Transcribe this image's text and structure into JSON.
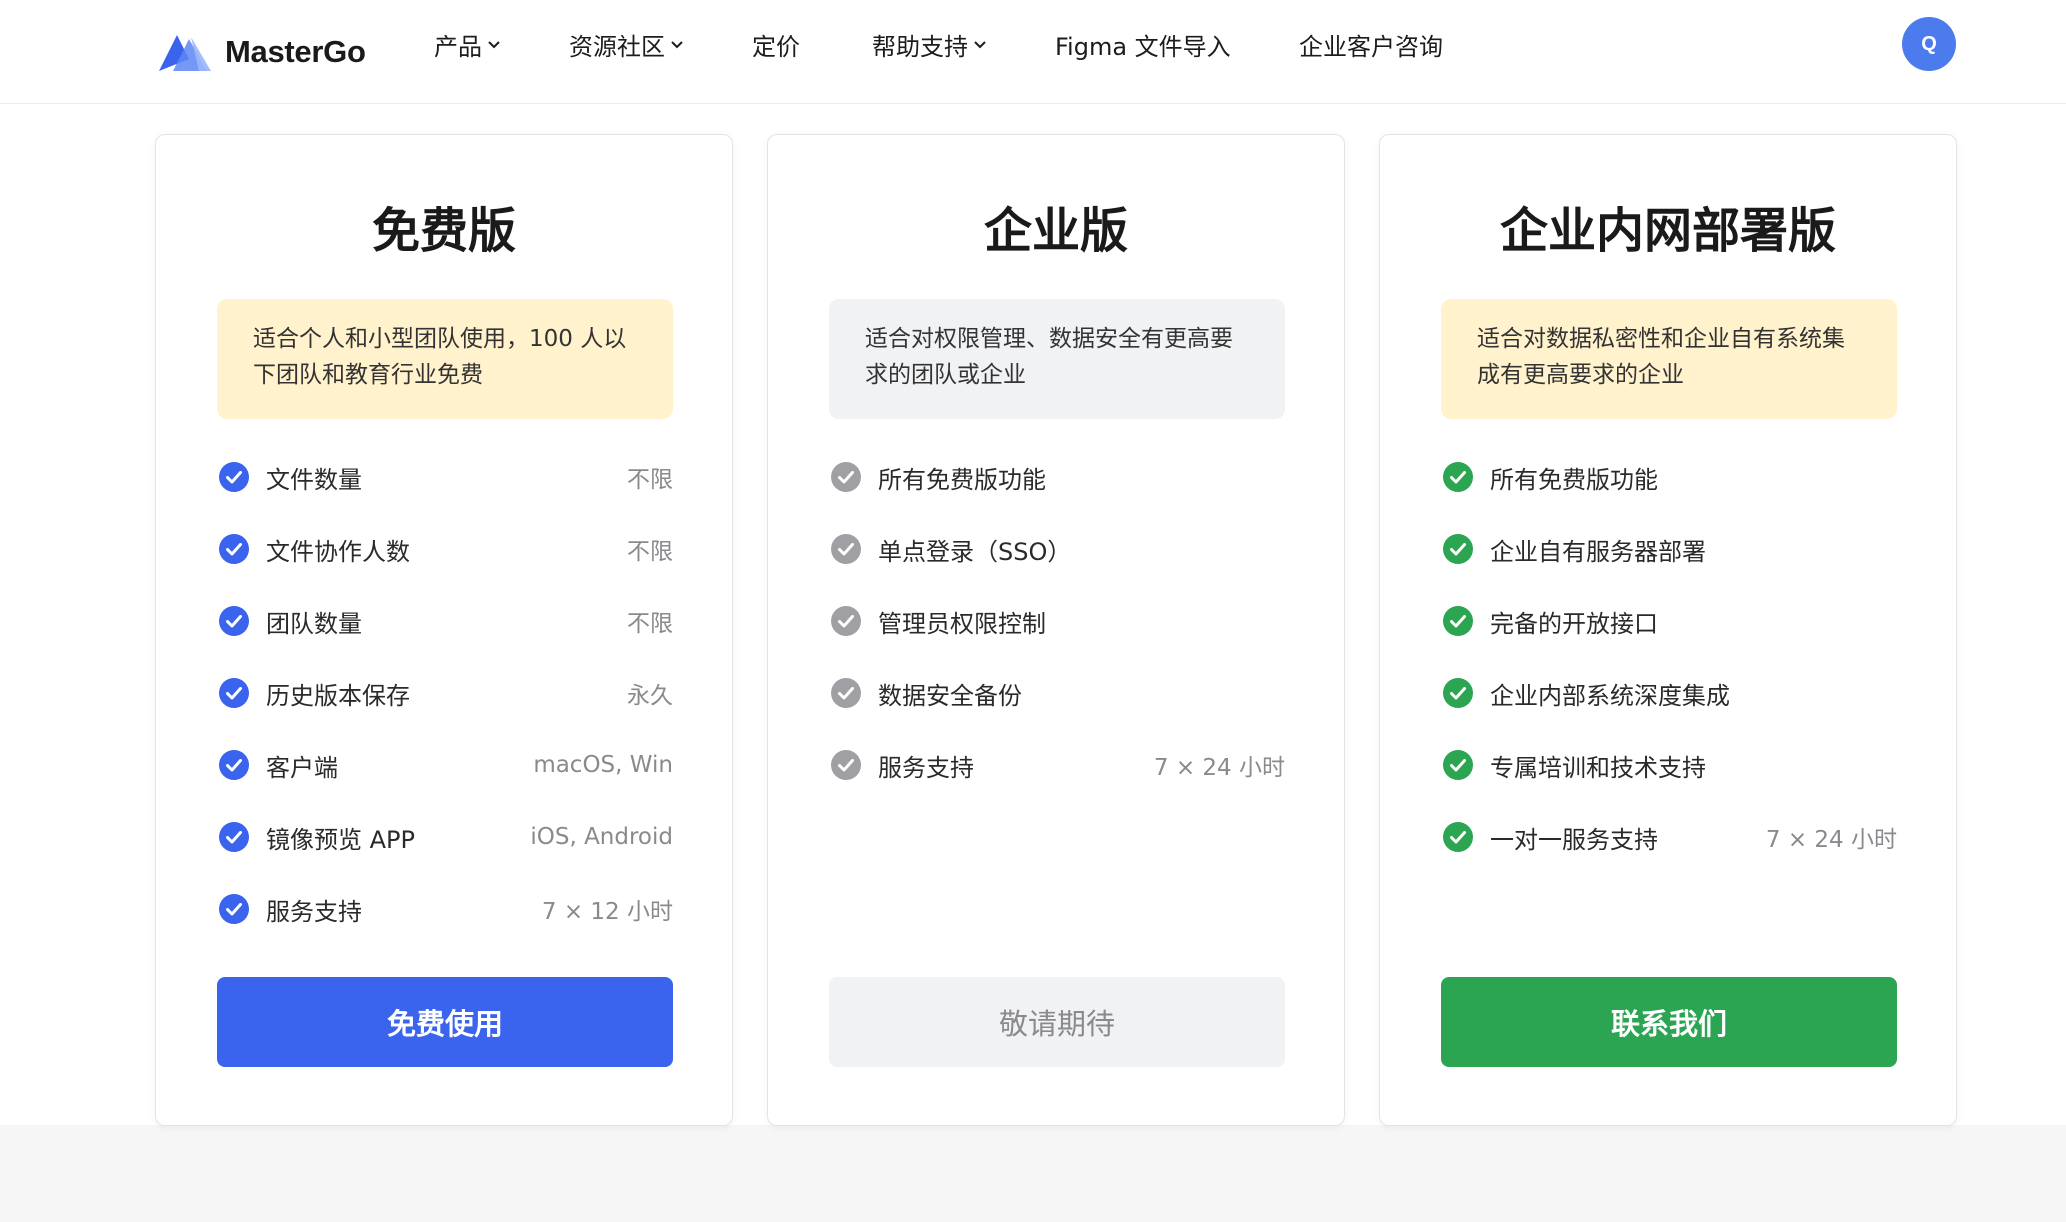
{
  "header": {
    "brand": "MasterGo",
    "nav": [
      {
        "label": "产品",
        "dropdown": true
      },
      {
        "label": "资源社区",
        "dropdown": true
      },
      {
        "label": "定价",
        "dropdown": false
      },
      {
        "label": "帮助支持",
        "dropdown": true
      },
      {
        "label": "Figma 文件导入",
        "dropdown": false
      },
      {
        "label": "企业客户咨询",
        "dropdown": false
      }
    ],
    "avatar_initial": "Q"
  },
  "colors": {
    "brand_blue": "#3a63ee",
    "check_blue": "#3a63ee",
    "check_gray": "#a0a0a4",
    "check_green": "#2ba552",
    "highlight_yellow": "#fff2cc",
    "muted_gray": "#f1f2f4"
  },
  "plans": [
    {
      "title": "免费版",
      "description": [
        "适合个人和小型团队使用，100 人以",
        "下团队和教育行业免费"
      ],
      "features": [
        {
          "name": "文件数量",
          "value": "不限"
        },
        {
          "name": "文件协作人数",
          "value": "不限"
        },
        {
          "name": "团队数量",
          "value": "不限"
        },
        {
          "name": "历史版本保存",
          "value": "永久"
        },
        {
          "name": "客户端",
          "value": "macOS, Win"
        },
        {
          "name": "镜像预览 APP",
          "value": "iOS, Android"
        },
        {
          "name": "服务支持",
          "value": "7 × 12 小时"
        }
      ],
      "cta": "免费使用"
    },
    {
      "title": "企业版",
      "description": [
        "适合对权限管理、数据安全有更高要",
        "求的团队或企业"
      ],
      "features": [
        {
          "name": "所有免费版功能",
          "value": ""
        },
        {
          "name": "单点登录（SSO）",
          "value": ""
        },
        {
          "name": "管理员权限控制",
          "value": ""
        },
        {
          "name": "数据安全备份",
          "value": ""
        },
        {
          "name": "服务支持",
          "value": "7 × 24 小时"
        }
      ],
      "cta": "敬请期待"
    },
    {
      "title": "企业内网部署版",
      "description": [
        "适合对数据私密性和企业自有系统集",
        "成有更高要求的企业"
      ],
      "features": [
        {
          "name": "所有免费版功能",
          "value": ""
        },
        {
          "name": "企业自有服务器部署",
          "value": ""
        },
        {
          "name": "完备的开放接口",
          "value": ""
        },
        {
          "name": "企业内部系统深度集成",
          "value": ""
        },
        {
          "name": "专属培训和技术支持",
          "value": ""
        },
        {
          "name": "一对一服务支持",
          "value": "7 × 24 小时"
        }
      ],
      "cta": "联系我们"
    }
  ]
}
